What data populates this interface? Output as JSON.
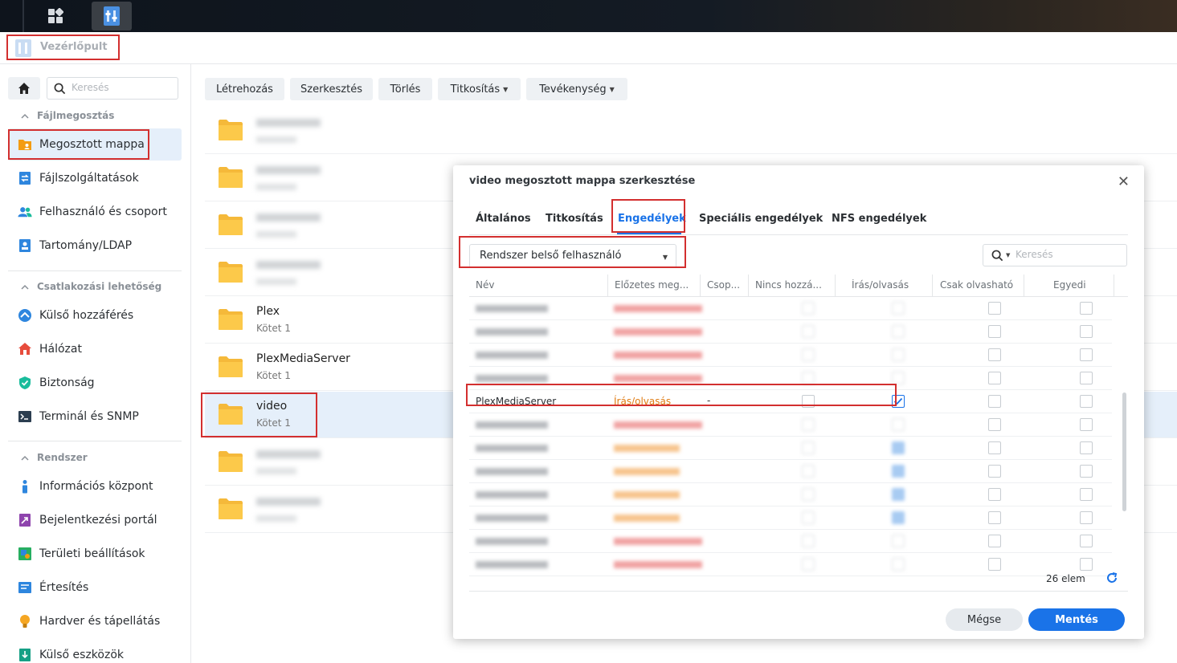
{
  "window": {
    "title": "Vezérlőpult"
  },
  "sidebar": {
    "search_placeholder": "Keresés",
    "sections": [
      {
        "title": "Fájlmegosztás",
        "items": [
          "Megosztott mappa",
          "Fájlszolgáltatások",
          "Felhasználó és csoport",
          "Tartomány/LDAP"
        ]
      },
      {
        "title": "Csatlakozási lehetőség",
        "items": [
          "Külső hozzáférés",
          "Hálózat",
          "Biztonság",
          "Terminál és SNMP"
        ]
      },
      {
        "title": "Rendszer",
        "items": [
          "Információs központ",
          "Bejelentkezési portál",
          "Területi beállítások",
          "Értesítés",
          "Hardver és tápellátás",
          "Külső eszközök"
        ]
      }
    ],
    "active_item": "Megosztott mappa"
  },
  "toolbar": {
    "create": "Létrehozás",
    "edit": "Szerkesztés",
    "delete": "Törlés",
    "encryption": "Titkosítás",
    "action": "Tevékenység"
  },
  "files": [
    {
      "name": "",
      "sub": "",
      "blurred": true
    },
    {
      "name": "",
      "sub": "",
      "blurred": true
    },
    {
      "name": "",
      "sub": "",
      "blurred": true
    },
    {
      "name": "",
      "sub": "",
      "blurred": true
    },
    {
      "name": "Plex",
      "sub": "Kötet 1"
    },
    {
      "name": "PlexMediaServer",
      "sub": "Kötet 1"
    },
    {
      "name": "video",
      "sub": "Kötet 1",
      "selected": true
    },
    {
      "name": "",
      "sub": "",
      "blurred": true
    },
    {
      "name": "",
      "sub": "",
      "blurred": true
    }
  ],
  "dialog": {
    "title": "video megosztott mappa szerkesztése",
    "tabs": [
      "Általános",
      "Titkosítás",
      "Engedélyek",
      "Speciális engedélyek",
      "NFS engedélyek"
    ],
    "active_tab": "Engedélyek",
    "user_type_select": "Rendszer belső felhasználó",
    "search_placeholder": "Keresés",
    "columns": [
      "Név",
      "Előzetes meg...",
      "Csop...",
      "Nincs hozzá...",
      "Írás/olvasás",
      "Csak olvasható",
      "Egyedi"
    ],
    "visible_row": {
      "name": "PlexMediaServer",
      "preview": "Írás/olvasás",
      "group": "-",
      "read_write": true
    },
    "count_label": "26 elem",
    "cancel": "Mégse",
    "save": "Mentés"
  },
  "colors": {
    "accent": "#1a73e8",
    "highlight": "#d32f2f",
    "permission_text": "#e07b12"
  }
}
